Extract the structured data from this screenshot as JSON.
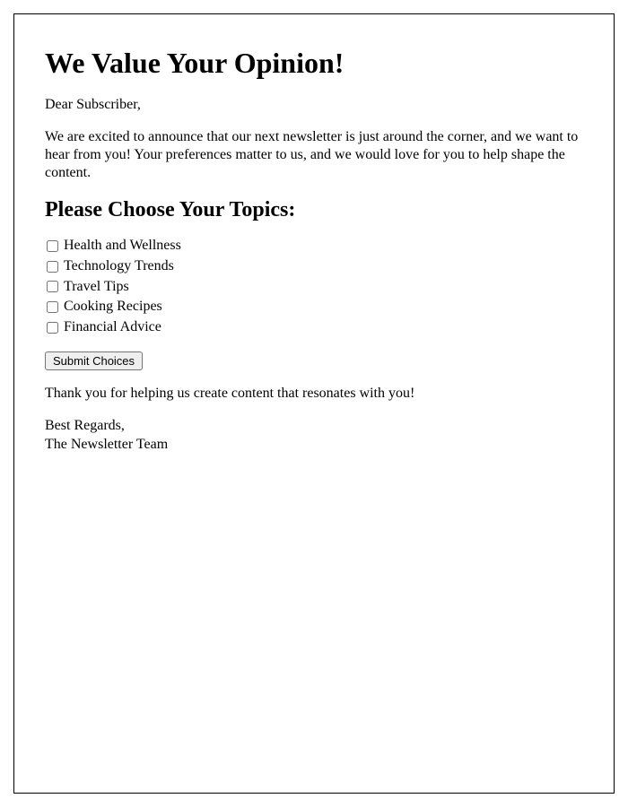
{
  "title": "We Value Your Opinion!",
  "greeting": "Dear Subscriber,",
  "intro": "We are excited to announce that our next newsletter is just around the corner, and we want to hear from you! Your preferences matter to us, and we would love for you to help shape the content.",
  "topics_heading": "Please Choose Your Topics:",
  "topics": [
    "Health and Wellness",
    "Technology Trends",
    "Travel Tips",
    "Cooking Recipes",
    "Financial Advice"
  ],
  "submit_label": "Submit Choices",
  "thankyou": "Thank you for helping us create content that resonates with you!",
  "closing_line1": "Best Regards,",
  "closing_line2": "The Newsletter Team"
}
